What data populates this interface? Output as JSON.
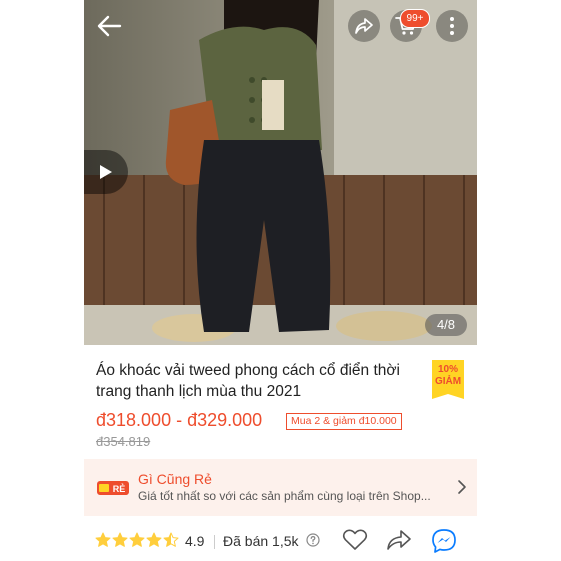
{
  "gallery": {
    "cart_count": "99+",
    "page_indicator": "4/8"
  },
  "product": {
    "title": "Áo khoác vải tweed phong cách cổ điển thời trang thanh lịch mùa thu 2021",
    "discount_percent": "10%",
    "discount_label": "GIẢM",
    "price_range": "đ318.000 - đ329.000",
    "original_price": "đ354.819",
    "promo": "Mua 2 & giảm đ10.000"
  },
  "cheap_banner": {
    "logo_text": "RẺ",
    "title": "Gì Cũng Rẻ",
    "subtitle": "Giá tốt nhất so với các sản phẩm cùng loại trên Shop..."
  },
  "stats": {
    "rating_value": "4.9",
    "stars_filled": 4.5,
    "sold": "Đã bán 1,5k"
  },
  "colors": {
    "brand": "#ee4d2d",
    "discount_bg": "#ffd424",
    "banner_bg": "#fdf1ec",
    "star": "#ffce3d",
    "messenger": "#0a7cff"
  },
  "icons": [
    "back-arrow-icon",
    "share-icon",
    "cart-icon",
    "more-icon",
    "play-icon",
    "chevron-right-icon",
    "star-icon",
    "help-icon",
    "heart-icon",
    "messenger-icon"
  ]
}
